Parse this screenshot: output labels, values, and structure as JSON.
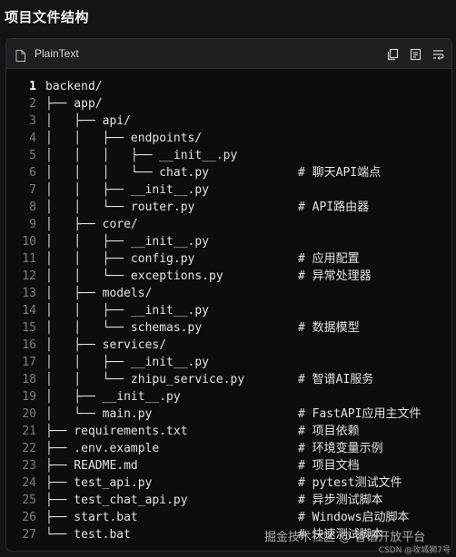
{
  "heading": "项目文件结构",
  "codebar": {
    "language": "PlainText",
    "file_icon": "file-icon",
    "tools": [
      "collapse-icon",
      "copy-icon",
      "wrap-icon"
    ]
  },
  "lines": [
    {
      "num": "1",
      "text": "backend/",
      "comment": ""
    },
    {
      "num": "2",
      "text": "├── app/",
      "comment": ""
    },
    {
      "num": "3",
      "text": "│   ├── api/",
      "comment": ""
    },
    {
      "num": "4",
      "text": "│   │   ├── endpoints/",
      "comment": ""
    },
    {
      "num": "5",
      "text": "│   │   │   ├── __init__.py",
      "comment": ""
    },
    {
      "num": "6",
      "text": "│   │   │   └── chat.py",
      "comment": "# 聊天API端点"
    },
    {
      "num": "7",
      "text": "│   │   ├── __init__.py",
      "comment": ""
    },
    {
      "num": "8",
      "text": "│   │   └── router.py",
      "comment": "# API路由器"
    },
    {
      "num": "9",
      "text": "│   ├── core/",
      "comment": ""
    },
    {
      "num": "10",
      "text": "│   │   ├── __init__.py",
      "comment": ""
    },
    {
      "num": "11",
      "text": "│   │   ├── config.py",
      "comment": "# 应用配置"
    },
    {
      "num": "12",
      "text": "│   │   └── exceptions.py",
      "comment": "# 异常处理器"
    },
    {
      "num": "13",
      "text": "│   ├── models/",
      "comment": ""
    },
    {
      "num": "14",
      "text": "│   │   ├── __init__.py",
      "comment": ""
    },
    {
      "num": "15",
      "text": "│   │   └── schemas.py",
      "comment": "# 数据模型"
    },
    {
      "num": "16",
      "text": "│   ├── services/",
      "comment": ""
    },
    {
      "num": "17",
      "text": "│   │   ├── __init__.py",
      "comment": ""
    },
    {
      "num": "18",
      "text": "│   │   └── zhipu_service.py",
      "comment": "# 智谱AI服务"
    },
    {
      "num": "19",
      "text": "│   ├── __init__.py",
      "comment": ""
    },
    {
      "num": "20",
      "text": "│   └── main.py",
      "comment": "# FastAPI应用主文件"
    },
    {
      "num": "21",
      "text": "├── requirements.txt",
      "comment": "# 项目依赖"
    },
    {
      "num": "22",
      "text": "├── .env.example",
      "comment": "# 环境变量示例"
    },
    {
      "num": "23",
      "text": "├── README.md",
      "comment": "# 项目文档"
    },
    {
      "num": "24",
      "text": "├── test_api.py",
      "comment": "# pytest测试文件"
    },
    {
      "num": "25",
      "text": "├── test_chat_api.py",
      "comment": "# 异步测试脚本"
    },
    {
      "num": "26",
      "text": "├── start.bat",
      "comment": "# Windows启动脚本"
    },
    {
      "num": "27",
      "text": "└── test.bat",
      "comment": "# 快速测试脚本"
    }
  ],
  "watermark": {
    "overlay": "掘金技术社区 @ 智谱开放平台",
    "footer": "CSDN @攻城狮7号"
  }
}
